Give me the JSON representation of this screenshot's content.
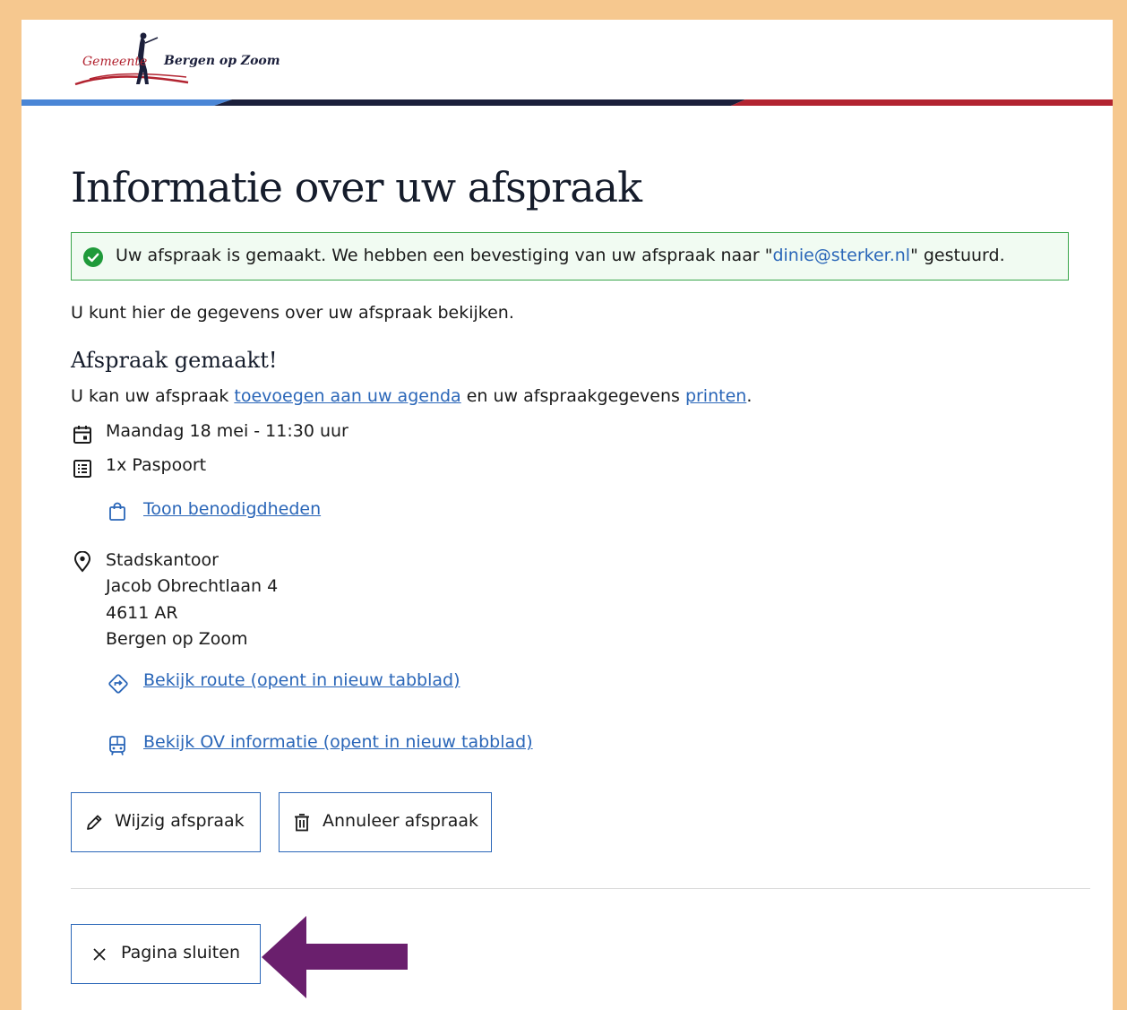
{
  "header": {
    "logo_text_left": "Gemeente",
    "logo_text_right": "Bergen op Zoom",
    "stripe_colors": [
      "#4a86d6",
      "#1b1f3b",
      "#b22330"
    ]
  },
  "page": {
    "title": "Informatie over uw afspraak",
    "alert": {
      "prefix": "Uw afspraak is gemaakt. We hebben een bevestiging van uw afspraak naar \"",
      "email": "dinie@sterker.nl",
      "suffix": "\" gestuurd.",
      "icon": "check-circle-icon",
      "color": "#3aa64b"
    },
    "intro": "U kunt hier de gegevens over uw afspraak bekijken.",
    "subheading": "Afspraak gemaakt!",
    "add_line": {
      "prefix": "U kan uw afspraak ",
      "agenda_link": "toevoegen aan uw agenda",
      "middle": " en uw afspraakgegevens ",
      "print_link": "printen",
      "suffix": "."
    },
    "date_time": "Maandag 18 mei - 11:30 uur",
    "product": "1x Paspoort",
    "requirements_link": "Toon benodigdheden",
    "location": {
      "name": "Stadskantoor",
      "street": "Jacob Obrechtlaan 4",
      "postcode": "4611 AR",
      "city": "Bergen op Zoom"
    },
    "route_link": "Bekijk route (opent in nieuw tabblad)",
    "ov_link": "Bekijk OV informatie (opent in nieuw tabblad)",
    "buttons": {
      "edit": "Wijzig afspraak",
      "cancel": "Annuleer afspraak",
      "close": "Pagina sluiten"
    },
    "accent_color": "#2a66b8",
    "annotation_arrow_color": "#6a1f6d"
  }
}
